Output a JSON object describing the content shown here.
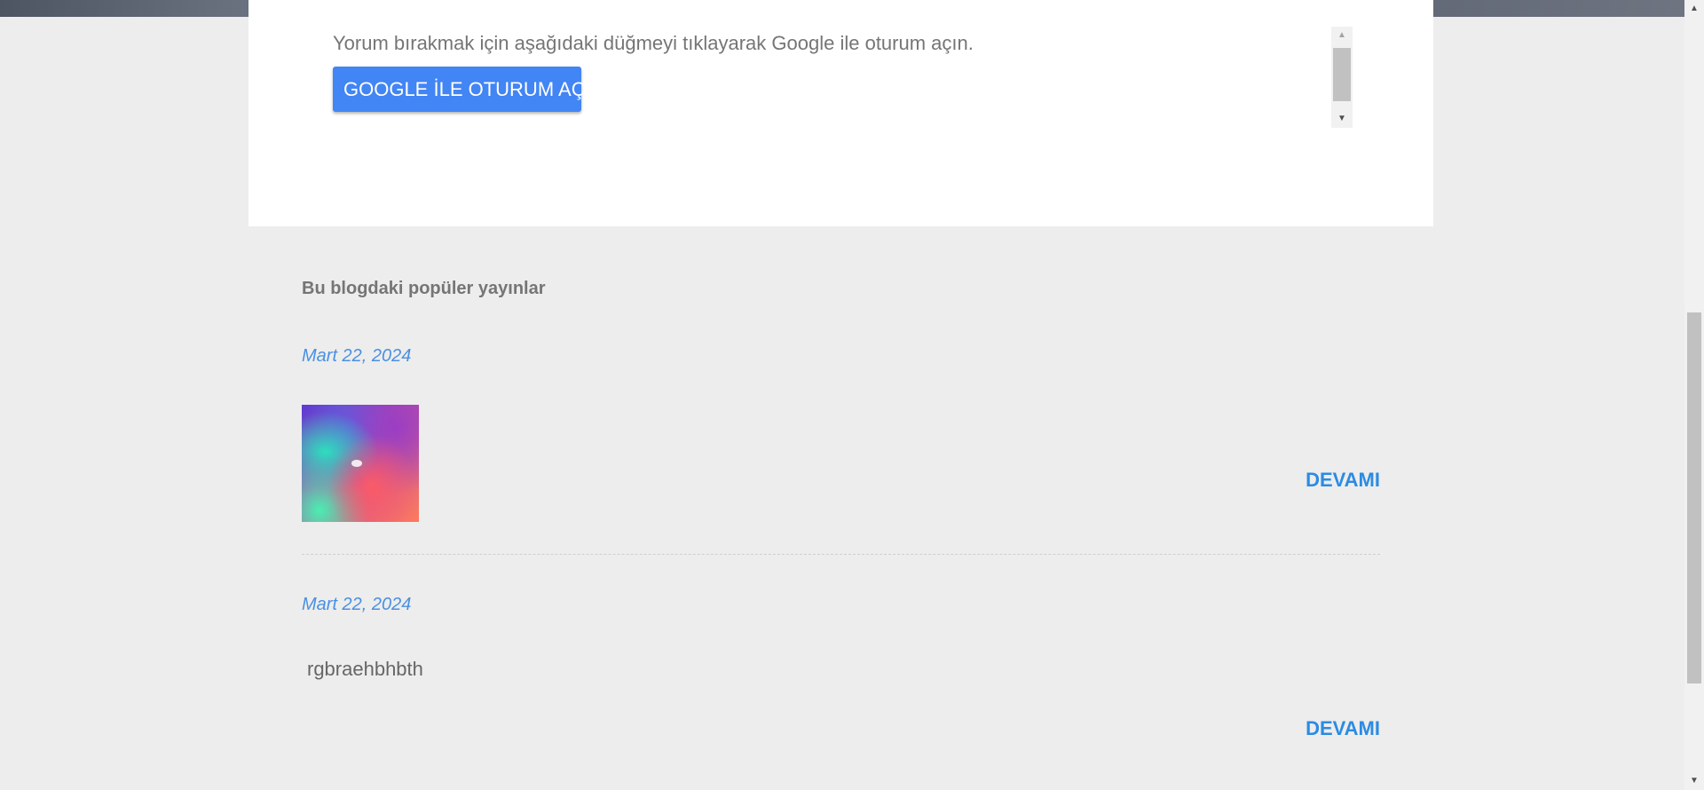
{
  "comment_section": {
    "signin_prompt": "Yorum bırakmak için aşağıdaki düğmeyi tıklayarak Google ile oturum açın.",
    "signin_button_label": "GOOGLE İLE OTURUM AÇ",
    "button_color": "#4285f4"
  },
  "popular_posts": {
    "heading": "Bu blogdaki popüler yayınlar",
    "posts": [
      {
        "date": "Mart 22, 2024",
        "snippet": "",
        "read_more_label": "DEVAMI"
      },
      {
        "date": "Mart 22, 2024",
        "snippet": "rgbraehbhbth",
        "read_more_label": "DEVAMI"
      }
    ]
  },
  "icons": {
    "frame_scroll_up": "▲",
    "frame_scroll_down": "▼",
    "page_scroll_up": "▲",
    "page_scroll_down": "▼"
  },
  "colors": {
    "link": "#2b8be3",
    "date": "#4a90e2",
    "background": "#ededed",
    "card": "#ffffff"
  }
}
